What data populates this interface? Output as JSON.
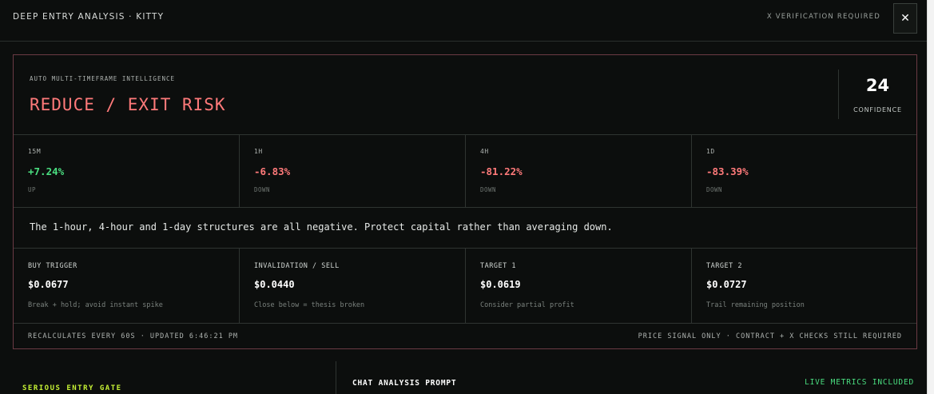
{
  "header": {
    "title": "DEEP ENTRY ANALYSIS · KITTY",
    "verification_note": "X VERIFICATION REQUIRED",
    "close_glyph": "✕"
  },
  "card": {
    "eyebrow": "AUTO MULTI-TIMEFRAME INTELLIGENCE",
    "verdict": "REDUCE / EXIT RISK",
    "confidence": {
      "value": "24",
      "label": "CONFIDENCE"
    },
    "timeframes": [
      {
        "label": "15M",
        "change": "+7.24%",
        "direction": "UP"
      },
      {
        "label": "1H",
        "change": "-6.83%",
        "direction": "DOWN"
      },
      {
        "label": "4H",
        "change": "-81.22%",
        "direction": "DOWN"
      },
      {
        "label": "1D",
        "change": "-83.39%",
        "direction": "DOWN"
      }
    ],
    "summary": "The 1-hour, 4-hour and 1-day structures are all negative. Protect capital rather than averaging down.",
    "levels": [
      {
        "label": "BUY TRIGGER",
        "value": "$0.0677",
        "note": "Break + hold; avoid instant spike"
      },
      {
        "label": "INVALIDATION / SELL",
        "value": "$0.0440",
        "note": "Close below = thesis broken"
      },
      {
        "label": "TARGET 1",
        "value": "$0.0619",
        "note": "Consider partial profit"
      },
      {
        "label": "TARGET 2",
        "value": "$0.0727",
        "note": "Trail remaining position"
      }
    ],
    "footer": {
      "left": "RECALCULATES EVERY 60S · UPDATED 6:46:21 PM",
      "right": "PRICE SIGNAL ONLY · CONTRACT + X CHECKS STILL REQUIRED"
    }
  },
  "bottom": {
    "gate_label": "SERIOUS ENTRY GATE",
    "chat_label": "CHAT ANALYSIS PROMPT",
    "live_label": "LIVE METRICS INCLUDED"
  },
  "colors": {
    "accent_red": "#ff7a7a",
    "accent_green": "#4ade80",
    "accent_lime": "#c6f135",
    "card_border": "#6b3a44"
  }
}
